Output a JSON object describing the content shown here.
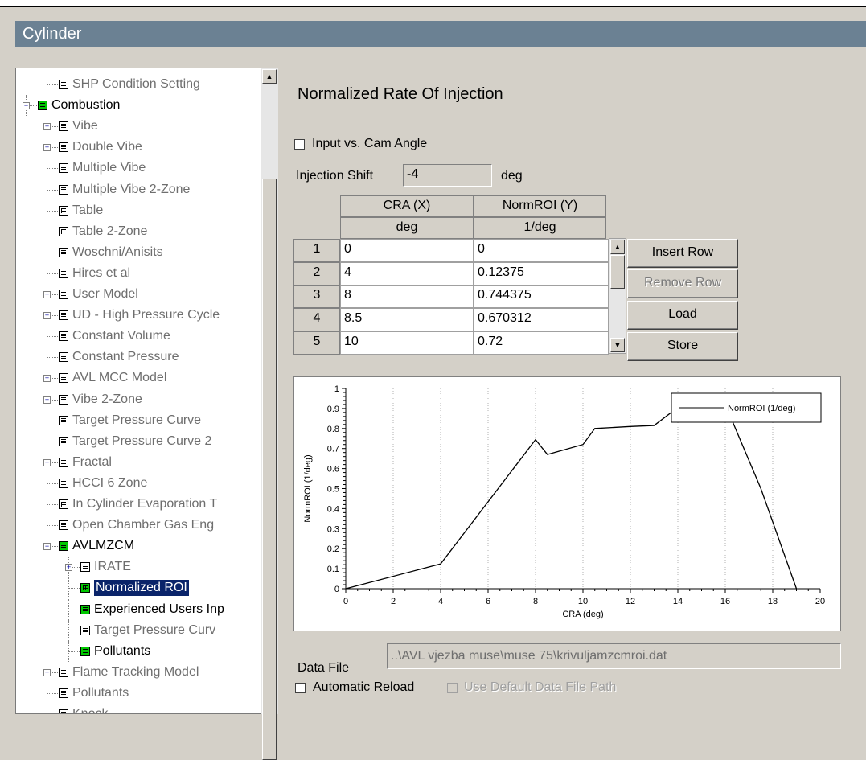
{
  "window": {
    "title": "Cylinder"
  },
  "tree": {
    "items": [
      {
        "label": "SHP Condition Setting",
        "icon": "grid-icon",
        "style": "grey",
        "indent": 1,
        "expander": "none"
      },
      {
        "label": "Combustion",
        "icon": "green-grid-icon",
        "style": "normal",
        "indent": 0,
        "expander": "minus"
      },
      {
        "label": "Vibe",
        "icon": "grid-icon",
        "style": "grey",
        "indent": 1,
        "expander": "plus"
      },
      {
        "label": "Double Vibe",
        "icon": "grid-icon",
        "style": "grey",
        "indent": 1,
        "expander": "plus"
      },
      {
        "label": "Multiple Vibe",
        "icon": "grid-icon",
        "style": "grey",
        "indent": 1,
        "expander": "none"
      },
      {
        "label": "Multiple Vibe 2-Zone",
        "icon": "grid-icon",
        "style": "grey",
        "indent": 1,
        "expander": "none"
      },
      {
        "label": "Table",
        "icon": "table-icon",
        "style": "grey",
        "indent": 1,
        "expander": "none"
      },
      {
        "label": "Table 2-Zone",
        "icon": "table-icon",
        "style": "grey",
        "indent": 1,
        "expander": "none"
      },
      {
        "label": "Woschni/Anisits",
        "icon": "grid-icon",
        "style": "grey",
        "indent": 1,
        "expander": "none"
      },
      {
        "label": "Hires et al",
        "icon": "grid-icon",
        "style": "grey",
        "indent": 1,
        "expander": "none"
      },
      {
        "label": "User Model",
        "icon": "grid-icon",
        "style": "grey",
        "indent": 1,
        "expander": "plus"
      },
      {
        "label": "UD - High Pressure Cycle",
        "icon": "grid-icon",
        "style": "grey",
        "indent": 1,
        "expander": "plus"
      },
      {
        "label": "Constant Volume",
        "icon": "grid-icon",
        "style": "grey",
        "indent": 1,
        "expander": "none"
      },
      {
        "label": "Constant Pressure",
        "icon": "grid-icon",
        "style": "grey",
        "indent": 1,
        "expander": "none"
      },
      {
        "label": "AVL MCC Model",
        "icon": "grid-icon",
        "style": "grey",
        "indent": 1,
        "expander": "plus"
      },
      {
        "label": "Vibe 2-Zone",
        "icon": "grid-icon",
        "style": "grey",
        "indent": 1,
        "expander": "plus"
      },
      {
        "label": "Target Pressure Curve",
        "icon": "grid-icon",
        "style": "grey",
        "indent": 1,
        "expander": "none"
      },
      {
        "label": "Target Pressure Curve 2",
        "icon": "grid-icon",
        "style": "grey",
        "indent": 1,
        "expander": "none"
      },
      {
        "label": "Fractal",
        "icon": "grid-icon",
        "style": "grey",
        "indent": 1,
        "expander": "plus"
      },
      {
        "label": "HCCI 6 Zone",
        "icon": "grid-icon",
        "style": "grey",
        "indent": 1,
        "expander": "none"
      },
      {
        "label": "In Cylinder Evaporation T",
        "icon": "table-icon",
        "style": "grey",
        "indent": 1,
        "expander": "none"
      },
      {
        "label": "Open Chamber Gas Eng",
        "icon": "grid-icon",
        "style": "grey",
        "indent": 1,
        "expander": "none"
      },
      {
        "label": "AVLMZCM",
        "icon": "green-grid-icon",
        "style": "normal",
        "indent": 1,
        "expander": "minus"
      },
      {
        "label": "IRATE",
        "icon": "grid-icon",
        "style": "grey",
        "indent": 2,
        "expander": "plus"
      },
      {
        "label": "Normalized ROI",
        "icon": "green-table-icon",
        "style": "selected",
        "indent": 2,
        "expander": "none"
      },
      {
        "label": "Experienced Users Inp",
        "icon": "green-grid-icon",
        "style": "normal",
        "indent": 2,
        "expander": "none"
      },
      {
        "label": "Target Pressure Curv",
        "icon": "grid-icon",
        "style": "grey",
        "indent": 2,
        "expander": "none"
      },
      {
        "label": "Pollutants",
        "icon": "green-grid-icon",
        "style": "normal",
        "indent": 2,
        "expander": "none"
      },
      {
        "label": "Flame Tracking Model",
        "icon": "grid-icon",
        "style": "grey",
        "indent": 1,
        "expander": "plus"
      },
      {
        "label": "Pollutants",
        "icon": "grid-icon",
        "style": "grey",
        "indent": 1,
        "expander": "none"
      },
      {
        "label": "Knock",
        "icon": "grid-icon",
        "style": "grey",
        "indent": 1,
        "expander": "none"
      }
    ]
  },
  "panel": {
    "title": "Normalized Rate Of Injection",
    "cam_angle_label": "Input vs. Cam Angle",
    "cam_angle_checked": false,
    "injection_shift_label": "Injection Shift",
    "injection_shift_value": "-4",
    "injection_shift_unit": "deg"
  },
  "table": {
    "columns": [
      {
        "name": "CRA (X)",
        "unit": "deg"
      },
      {
        "name": "NormROI (Y)",
        "unit": "1/deg"
      }
    ],
    "rows": [
      {
        "n": "1",
        "x": "0",
        "y": "0"
      },
      {
        "n": "2",
        "x": "4",
        "y": "0.12375"
      },
      {
        "n": "3",
        "x": "8",
        "y": "0.744375"
      },
      {
        "n": "4",
        "x": "8.5",
        "y": "0.670312"
      },
      {
        "n": "5",
        "x": "10",
        "y": "0.72"
      }
    ]
  },
  "buttons": {
    "insert_row": "Insert Row",
    "remove_row": "Remove Row",
    "load": "Load",
    "store": "Store"
  },
  "chart_data": {
    "type": "line",
    "xlabel": "CRA (deg)",
    "ylabel": "NormROI (1/deg)",
    "xlim": [
      0,
      20
    ],
    "ylim": [
      0,
      1
    ],
    "xticks": [
      "0",
      "2",
      "4",
      "6",
      "8",
      "10",
      "12",
      "14",
      "16",
      "18",
      "20"
    ],
    "yticks": [
      "0",
      "0.1",
      "0.2",
      "0.3",
      "0.4",
      "0.5",
      "0.6",
      "0.7",
      "0.8",
      "0.9",
      "1"
    ],
    "grid": "vertical dotted",
    "legend_position": "top-right",
    "series": [
      {
        "name": "NormROI (1/deg)",
        "x": [
          0,
          4,
          8,
          8.5,
          10,
          10.5,
          12,
          13,
          14,
          15,
          16,
          17.5,
          19
        ],
        "y": [
          0,
          0.12375,
          0.744375,
          0.670312,
          0.72,
          0.8,
          0.81,
          0.815,
          0.905,
          0.92,
          0.92,
          0.5,
          0
        ]
      }
    ]
  },
  "datafile": {
    "label": "Data File",
    "value": "..\\AVL vjezba muse\\muse 75\\krivuljamzcmroi.dat",
    "auto_reload_label": "Automatic Reload",
    "auto_reload_checked": false,
    "default_path_label": "Use Default Data File Path",
    "default_path_checked": false
  }
}
